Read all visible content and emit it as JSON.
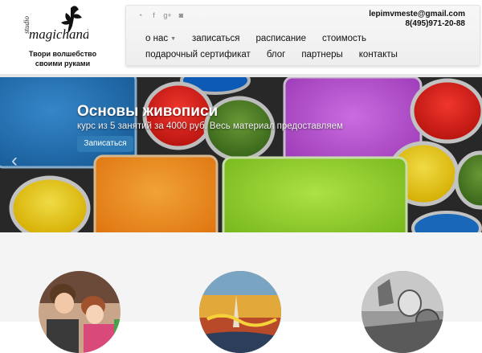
{
  "logo": {
    "alt_text": "studio magichands",
    "icon": "fairy-icon"
  },
  "tagline": {
    "line1": "Твори волшебство",
    "line2": "своими руками"
  },
  "social": [
    {
      "name": "rss",
      "icon": "rss-icon",
      "glyph": "◔"
    },
    {
      "name": "facebook",
      "icon": "facebook-icon",
      "glyph": "f"
    },
    {
      "name": "google-plus",
      "icon": "google-plus-icon",
      "glyph": "g+"
    },
    {
      "name": "instagram",
      "icon": "instagram-icon",
      "glyph": "◙"
    }
  ],
  "contacts": {
    "email": "lepimvmeste@gmail.com",
    "phone": "8(495)971-20-88"
  },
  "nav": {
    "row1": [
      "о нас",
      "записаться",
      "расписание",
      "стоимость"
    ],
    "row2": [
      "подарочный сертификат",
      "блог",
      "партнеры",
      "контакты"
    ]
  },
  "slide": {
    "title": "Основы живописи",
    "subtitle": "курс из 5 занятий за 4000 руб. Весь материал предоставляем",
    "button": "Записаться",
    "prev_glyph": "‹"
  },
  "colors": {
    "button_bg": "#2e7bb5",
    "paint_blue": "#1f6fb3",
    "paint_orange": "#f28a1a",
    "paint_green": "#8cc63f",
    "paint_magenta": "#b14ac7",
    "paint_red": "#e2231a",
    "paint_yellow": "#f5d000"
  }
}
